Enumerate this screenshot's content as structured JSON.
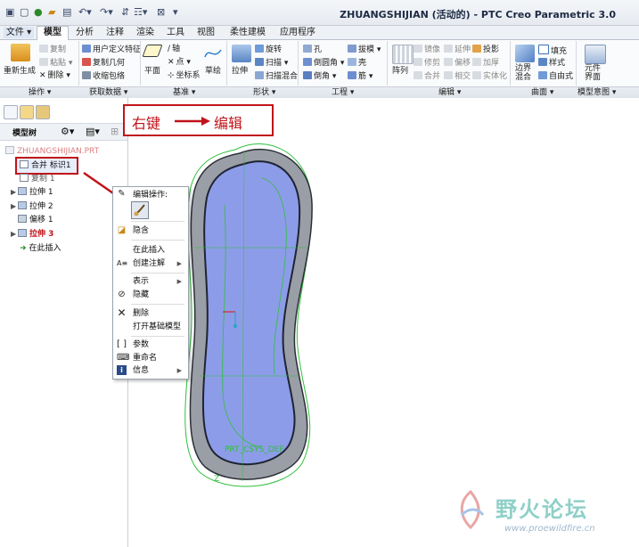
{
  "window": {
    "title": "ZHUANGSHIJIAN (活动的) - PTC Creo Parametric 3.0"
  },
  "tabs": [
    {
      "label": "文件 ▾",
      "name": "tab-file"
    },
    {
      "label": "模型",
      "name": "tab-model",
      "active": true
    },
    {
      "label": "分析",
      "name": "tab-analysis"
    },
    {
      "label": "注释",
      "name": "tab-annotate"
    },
    {
      "label": "渲染",
      "name": "tab-render"
    },
    {
      "label": "工具",
      "name": "tab-tools"
    },
    {
      "label": "视图",
      "name": "tab-view"
    },
    {
      "label": "柔性建模",
      "name": "tab-flexible-modeling"
    },
    {
      "label": "应用程序",
      "name": "tab-applications"
    }
  ],
  "ribbon": {
    "operations": {
      "regenerate": "重新生成",
      "copy": "复制",
      "paste": "粘贴",
      "delete": "删除"
    },
    "get_data": {
      "udf": "用户定义特征",
      "copy_geom": "复制几何",
      "shrinkwrap": "收缩包络"
    },
    "datum": {
      "plane": "平面",
      "axis": "轴",
      "point": "点",
      "csys": "坐标系",
      "sketch": "草绘"
    },
    "shapes": {
      "extrude": "拉伸",
      "revolve": "旋转",
      "sweep": "扫描",
      "swept_blend": "扫描混合"
    },
    "engineering": {
      "hole": "孔",
      "draft": "拔模",
      "round": "倒圆角",
      "shell": "壳",
      "chamfer": "倒角",
      "rib": "筋"
    },
    "editing": {
      "pattern": "阵列",
      "mirror": "镜像",
      "extend": "延伸",
      "project": "投影",
      "trim": "修剪",
      "offset": "偏移",
      "thicken": "加厚",
      "merge": "合并",
      "intersect": "相交",
      "solidify": "实体化"
    },
    "surfaces": {
      "fill": "填充",
      "boundary_blend": "边界\n混合",
      "style": "样式",
      "freestyle": "自由式"
    },
    "model_intent": {
      "component_interface": "元件\n界面"
    },
    "groups": {
      "operations": "操作 ▾",
      "get_data": "获取数据 ▾",
      "datum": "基准 ▾",
      "shapes": "形状 ▾",
      "engineering": "工程 ▾",
      "editing": "编辑 ▾",
      "surfaces": "曲面 ▾",
      "model_intent": "模型意图 ▾"
    }
  },
  "model_tree": {
    "header": "模型树",
    "items": [
      {
        "label": "ZHUANGSHIJIAN.PRT",
        "expander": ""
      },
      {
        "label": "合并 标识1",
        "expander": "",
        "selected": true
      },
      {
        "label": "复制 1",
        "expander": ""
      },
      {
        "label": "拉伸 1",
        "expander": "▶"
      },
      {
        "label": "拉伸 2",
        "expander": "▶"
      },
      {
        "label": "偏移 1",
        "expander": ""
      },
      {
        "label": "拉伸 3",
        "expander": "▶",
        "highlight": true
      },
      {
        "label": "在此插入",
        "expander": ""
      }
    ]
  },
  "context_menu": {
    "section_title": "编辑操作:",
    "items": {
      "suppress": "隐含",
      "insert_here": "在此插入",
      "create_annotation": "创建注解",
      "represent": "表示",
      "hide": "隐藏",
      "delete": "删除",
      "open_base_model": "打开基础模型",
      "parameters": "参数",
      "rename": "重命名",
      "info": "信息"
    }
  },
  "annotation": {
    "right_click": "右键",
    "edit": "编辑"
  },
  "graphics": {
    "csys_label": "PRT_CSYS_DEF",
    "csys_axis": "Z"
  },
  "watermark": {
    "name": "野火论坛",
    "url": "www.proewildfire.cn"
  },
  "colors": {
    "accent_red": "#c0141a",
    "model_fill": "#8d9ce8",
    "model_rim": "#9a9ea6",
    "edge_green": "#2fbf3a"
  }
}
